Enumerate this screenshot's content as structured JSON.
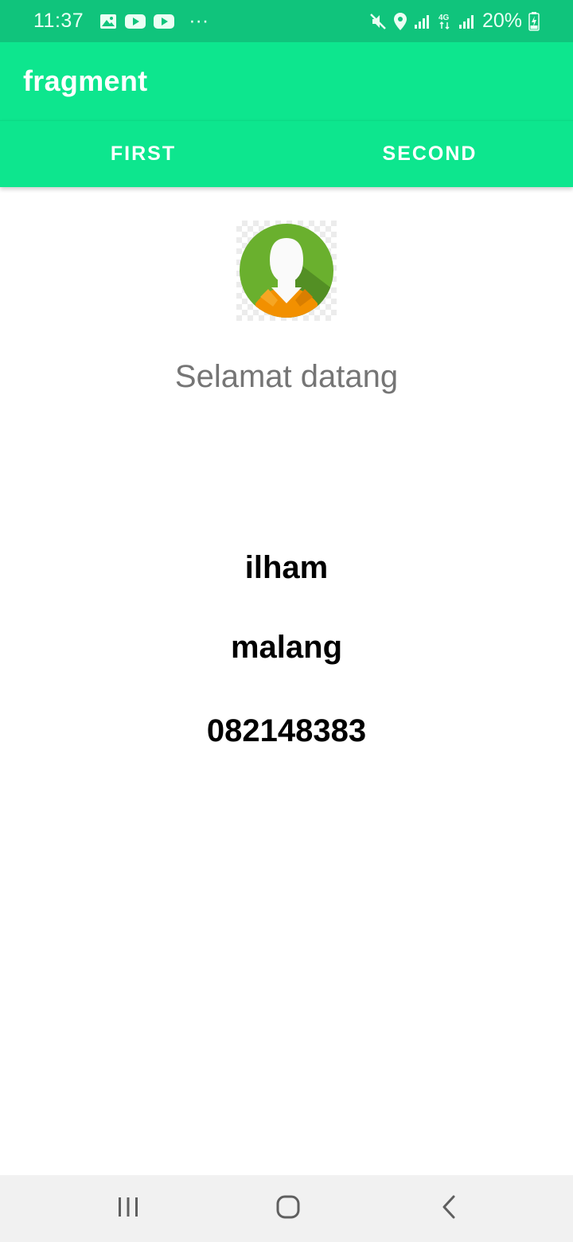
{
  "status_bar": {
    "time": "11:37",
    "left_icons": [
      "image-icon",
      "youtube-icon",
      "youtube-icon",
      "more-dots-icon"
    ],
    "more": "···",
    "right_icons": [
      "mute-icon",
      "location-icon",
      "signal-icon",
      "4g-icon",
      "signal-icon",
      "battery-charging-icon"
    ],
    "battery": "20%",
    "background": "#10c47c"
  },
  "app_bar": {
    "title": "fragment",
    "background": "#0de68e"
  },
  "tabs": [
    {
      "label": "FIRST"
    },
    {
      "label": "SECOND"
    }
  ],
  "content": {
    "avatar_icon": "user-avatar-icon",
    "welcome": "Selamat datang",
    "name": "ilham",
    "city": "malang",
    "phone": "082148383"
  },
  "nav_bar": {
    "icons": [
      "recent-apps-icon",
      "home-icon",
      "back-icon"
    ]
  },
  "colors": {
    "accent": "#0de68e",
    "avatar_green": "#6ab02e",
    "avatar_orange": "#f29000"
  }
}
